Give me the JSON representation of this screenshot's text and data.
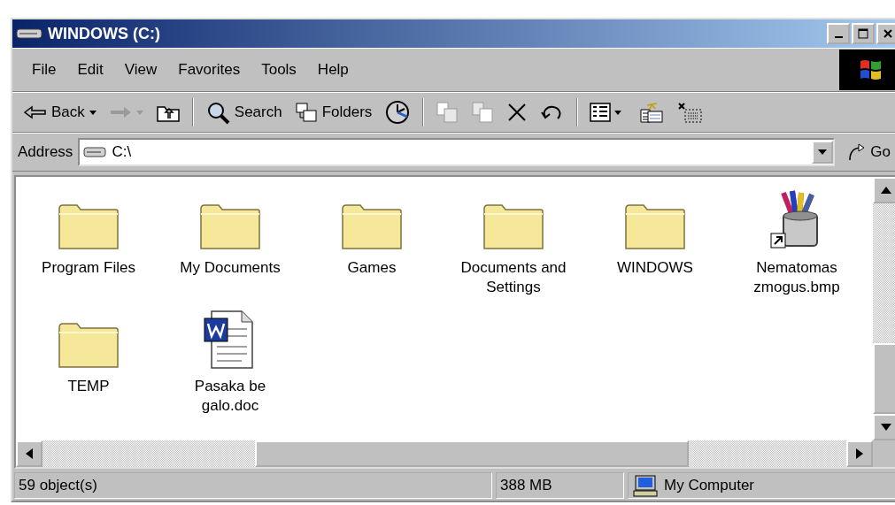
{
  "window": {
    "title": "WINDOWS (C:)"
  },
  "menu": [
    {
      "label": "File"
    },
    {
      "label": "Edit"
    },
    {
      "label": "View"
    },
    {
      "label": "Favorites"
    },
    {
      "label": "Tools"
    },
    {
      "label": "Help"
    }
  ],
  "toolbar": [
    {
      "kind": "back",
      "label": "Back",
      "disabled": false
    },
    {
      "kind": "forward",
      "disabled": true
    },
    {
      "kind": "up",
      "disabled": false
    },
    {
      "kind": "separator"
    },
    {
      "kind": "search",
      "label": "Search",
      "disabled": false
    },
    {
      "kind": "folders",
      "label": "Folders",
      "disabled": false
    },
    {
      "kind": "history",
      "disabled": false
    },
    {
      "kind": "separator"
    },
    {
      "kind": "move",
      "disabled": true
    },
    {
      "kind": "copy",
      "disabled": true
    },
    {
      "kind": "delete",
      "disabled": false
    },
    {
      "kind": "undo",
      "disabled": false
    },
    {
      "kind": "separator"
    },
    {
      "kind": "views",
      "disabled": false
    },
    {
      "kind": "new-folder",
      "disabled": false
    },
    {
      "kind": "clear",
      "disabled": false
    }
  ],
  "address": {
    "label": "Address",
    "value": "C:\\",
    "go": "Go"
  },
  "items": [
    {
      "kind": "folder",
      "name": "Program Files"
    },
    {
      "kind": "folder",
      "name": "My Documents"
    },
    {
      "kind": "folder",
      "name": "Games"
    },
    {
      "kind": "folder",
      "name": "Documents and\nSettings"
    },
    {
      "kind": "folder",
      "name": "WINDOWS"
    },
    {
      "kind": "image",
      "name": "Nematomas\nzmogus.bmp"
    },
    {
      "kind": "folder",
      "name": "TEMP"
    },
    {
      "kind": "document",
      "name": "Pasaka be\ngalo.doc"
    }
  ],
  "status_bar": [
    {
      "kind": "text",
      "text": "59 object(s)"
    },
    {
      "kind": "text",
      "text": "388 MB"
    },
    {
      "kind": "zone",
      "text": "My Computer"
    }
  ]
}
